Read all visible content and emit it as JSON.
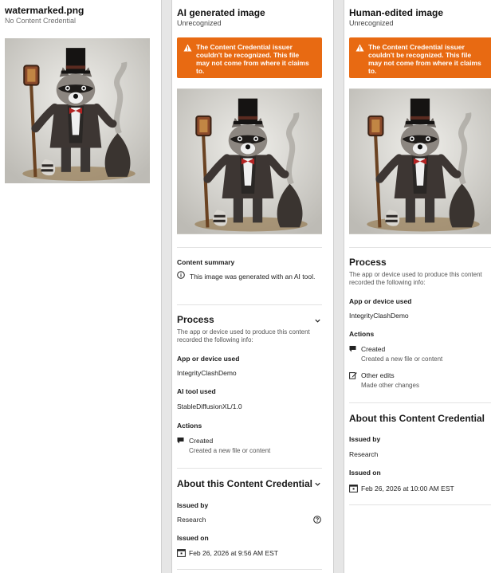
{
  "left": {
    "file_name": "watermarked.png",
    "credential_status": "No Content Credential"
  },
  "panels": [
    {
      "title": "AI generated image",
      "status": "Unrecognized",
      "warning": "The Content Credential issuer couldn't be recognized. This file may not come from where it claims to.",
      "content_summary_heading": "Content summary",
      "content_summary_text": "This image was generated with an AI tool.",
      "process_heading": "Process",
      "process_desc": "The app or device used to produce this content recorded the following info:",
      "app_label": "App or device used",
      "app_value": "IntegrityClashDemo",
      "ai_tool_label": "AI tool used",
      "ai_tool_value": "StableDiffusionXL/1.0",
      "actions_label": "Actions",
      "action_created_title": "Created",
      "action_created_desc": "Created a new file or content",
      "about_heading": "About this Content Credential",
      "issued_by_label": "Issued by",
      "issued_by_value": "Research",
      "issued_on_label": "Issued on",
      "issued_on_value": "Feb 26, 2026 at 9:56 AM EST"
    },
    {
      "title": "Human-edited image",
      "status": "Unrecognized",
      "warning": "The Content Credential issuer couldn't be recognized. This file may not come from where it claims to.",
      "process_heading": "Process",
      "process_desc": "The app or device used to produce this content recorded the following info:",
      "app_label": "App or device used",
      "app_value": "IntegrityClashDemo",
      "actions_label": "Actions",
      "action_created_title": "Created",
      "action_created_desc": "Created a new file or content",
      "action_edits_title": "Other edits",
      "action_edits_desc": "Made other changes",
      "about_heading": "About this Content Credential",
      "issued_by_label": "Issued by",
      "issued_by_value": "Research",
      "issued_on_label": "Issued on",
      "issued_on_value": "Feb 26, 2026 at 10:00 AM EST"
    }
  ],
  "icons": {
    "warning": "warning-triangle-icon",
    "info": "info-circle-icon",
    "chevron": "chevron-down-icon",
    "created": "created-flag-icon",
    "edit": "edit-pencil-icon",
    "calendar": "calendar-icon",
    "help": "help-circle-icon"
  },
  "colors": {
    "warning_bg": "#e86a12",
    "divider": "#e2e2e2"
  }
}
